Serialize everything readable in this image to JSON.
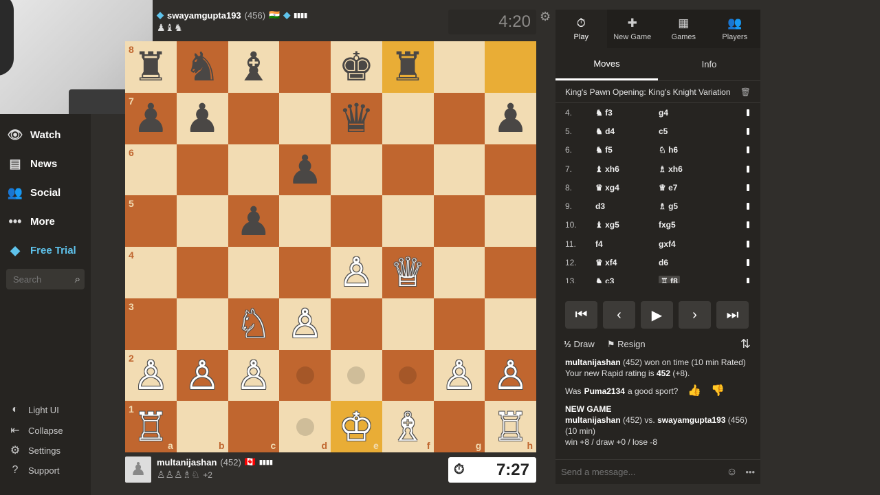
{
  "nav": {
    "watch": "Watch",
    "news": "News",
    "social": "Social",
    "more": "More",
    "free_trial": "Free Trial",
    "search_placeholder": "Search",
    "light_ui": "Light UI",
    "collapse": "Collapse",
    "settings": "Settings",
    "support": "Support"
  },
  "top_player": {
    "name": "swayamgupta193",
    "rating": "(456)",
    "flag": "🇮🇳",
    "captured": "♟♝♞",
    "clock": "4:20"
  },
  "bottom_player": {
    "name": "multanijashan",
    "rating": "(452)",
    "flag": "🇨🇦",
    "captured": "♙♙♙♗♘",
    "advantage": "+2",
    "clock": "7:27"
  },
  "board": {
    "ranks": [
      "8",
      "7",
      "6",
      "5",
      "4",
      "3",
      "2",
      "1"
    ],
    "files": [
      "a",
      "b",
      "c",
      "d",
      "e",
      "f",
      "g",
      "h"
    ],
    "rows": [
      [
        "b:♜",
        "b:♞",
        "b:♝",
        "",
        "b:♚",
        "b:♜",
        "",
        ""
      ],
      [
        "b:♟",
        "b:♟",
        "",
        "",
        "b:♛",
        "",
        "",
        "b:♟"
      ],
      [
        "",
        "",
        "",
        "b:♟",
        "",
        "",
        "",
        ""
      ],
      [
        "",
        "",
        "b:♟",
        "",
        "",
        "",
        "",
        ""
      ],
      [
        "",
        "",
        "",
        "",
        "w:♙",
        "w:♕",
        "",
        ""
      ],
      [
        "",
        "",
        "w:♘",
        "w:♙",
        "",
        "",
        "",
        ""
      ],
      [
        "w:♙",
        "w:♙",
        "w:♙",
        "dot",
        "dot",
        "dot",
        "w:♙",
        "w:♙"
      ],
      [
        "w:♖",
        "",
        "",
        "dot",
        "w:♔",
        "w:♗",
        "",
        "w:♖"
      ]
    ],
    "highlights": [
      "f8",
      "h8",
      "e1"
    ]
  },
  "right_tabs": [
    {
      "icon": "⏱",
      "label": "Play"
    },
    {
      "icon": "✚",
      "label": "New Game"
    },
    {
      "icon": "▦",
      "label": "Games"
    },
    {
      "icon": "👥",
      "label": "Players"
    }
  ],
  "move_tabs": {
    "moves": "Moves",
    "info": "Info"
  },
  "opening": "King's Pawn Opening: King's Knight Variation",
  "moves": [
    {
      "no": "4.",
      "w": "♞ f3",
      "b": "g4"
    },
    {
      "no": "5.",
      "w": "♞ d4",
      "b": "c5"
    },
    {
      "no": "6.",
      "w": "♞ f5",
      "b": "♘ h6"
    },
    {
      "no": "7.",
      "w": "♝ xh6",
      "b": "♗ xh6"
    },
    {
      "no": "8.",
      "w": "♛ xg4",
      "b": "♕ e7"
    },
    {
      "no": "9.",
      "w": "d3",
      "b": "♗ g5"
    },
    {
      "no": "10.",
      "w": "♝ xg5",
      "b": "fxg5"
    },
    {
      "no": "11.",
      "w": "f4",
      "b": "gxf4"
    },
    {
      "no": "12.",
      "w": "♛ xf4",
      "b": "d6"
    },
    {
      "no": "13.",
      "w": "♞ c3",
      "b": "♖ f8"
    }
  ],
  "actions": {
    "draw": "Draw",
    "resign": "Resign"
  },
  "chat": {
    "line1_name": "multanijashan",
    "line1_rest": "(452) won on time (10 min Rated)",
    "line2": "Your new Rapid rating is",
    "line2_rating": "452",
    "line2_delta": "(+8).",
    "sport_q1": "Was",
    "sport_name": "Puma2134",
    "sport_q2": "a good sport?",
    "new_game": "NEW GAME",
    "ng_p1": "multanijashan",
    "ng_r1": "(452) vs.",
    "ng_p2": "swayamgupta193",
    "ng_r2": "(456)",
    "ng_time": "(10 min)",
    "ng_stats": "win +8 / draw +0 / lose -8"
  },
  "message_placeholder": "Send a message..."
}
